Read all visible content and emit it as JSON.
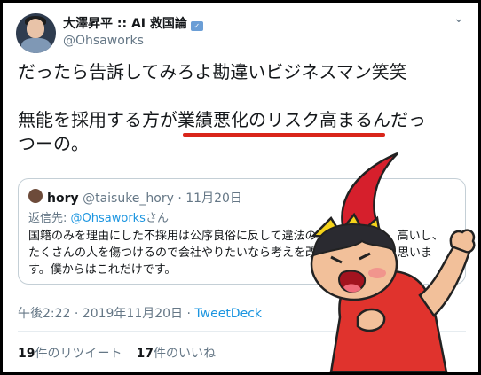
{
  "author": {
    "name": "大澤昇平 :: AI 救国論",
    "handle": "@Ohsaworks"
  },
  "tweet": {
    "lines": [
      "だったら告訴してみろよ勘違いビジネスマン笑笑",
      "無能を採用する方が業績悪化のリスク高まるんだっ",
      "つーの。"
    ]
  },
  "quoted_tweet": {
    "name": "hory",
    "handle_date": "@taisuke_hory · 11月20日",
    "reply_prefix": "返信先: ",
    "reply_mention": "@Ohsaworks",
    "reply_suffix": "さん",
    "body_lines": [
      "国籍のみを理由にした不採用は公序良俗に反して違法の　　　　　　　高いし、",
      "たくさんの人を傷つけるので会社やりたいなら考えを改　　　　　　と思いま",
      "す。僕からはこれだけです。"
    ]
  },
  "meta": {
    "time": "午後2:22 · 2019年11月20日 · ",
    "app": "TweetDeck"
  },
  "stats": {
    "retweets_count": "19",
    "retweets_label": "件のリツイート",
    "likes_count": "17",
    "likes_label": "件のいいね"
  },
  "icons": [
    "verified-icon",
    "caret-down-icon"
  ],
  "colors": {
    "accent": "#1b95e0",
    "underline": "#d9251a",
    "muted": "#657786"
  }
}
